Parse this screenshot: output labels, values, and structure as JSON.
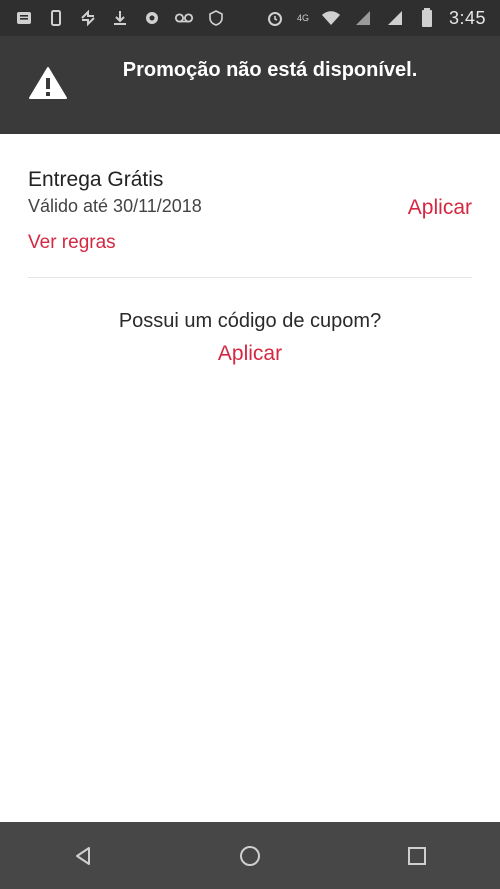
{
  "status_bar": {
    "time": "3:45",
    "left_icons": [
      "notification-icon",
      "phone-icon",
      "sync-icon",
      "download-icon",
      "settings-icon",
      "voicemail-icon",
      "security-icon"
    ],
    "right_icons": [
      "alarm-icon",
      "lte-icon",
      "wifi-icon",
      "signal-icon",
      "signal-icon",
      "battery-icon"
    ],
    "network_label": "4G"
  },
  "banner": {
    "icon": "warning-icon",
    "message": "Promoção não está disponível."
  },
  "promo": {
    "title": "Entrega Grátis",
    "validity": "Válido até 30/11/2018",
    "apply_label": "Aplicar",
    "rules_label": "Ver regras"
  },
  "coupon": {
    "question": "Possui um código de cupom?",
    "apply_label": "Aplicar"
  },
  "nav_bar": {
    "buttons": [
      "back-icon",
      "home-icon",
      "recents-icon"
    ]
  },
  "colors": {
    "accent": "#d42842",
    "banner_bg": "#3a3a3a",
    "status_bg": "#2f2f2f",
    "nav_bg": "#474747"
  }
}
